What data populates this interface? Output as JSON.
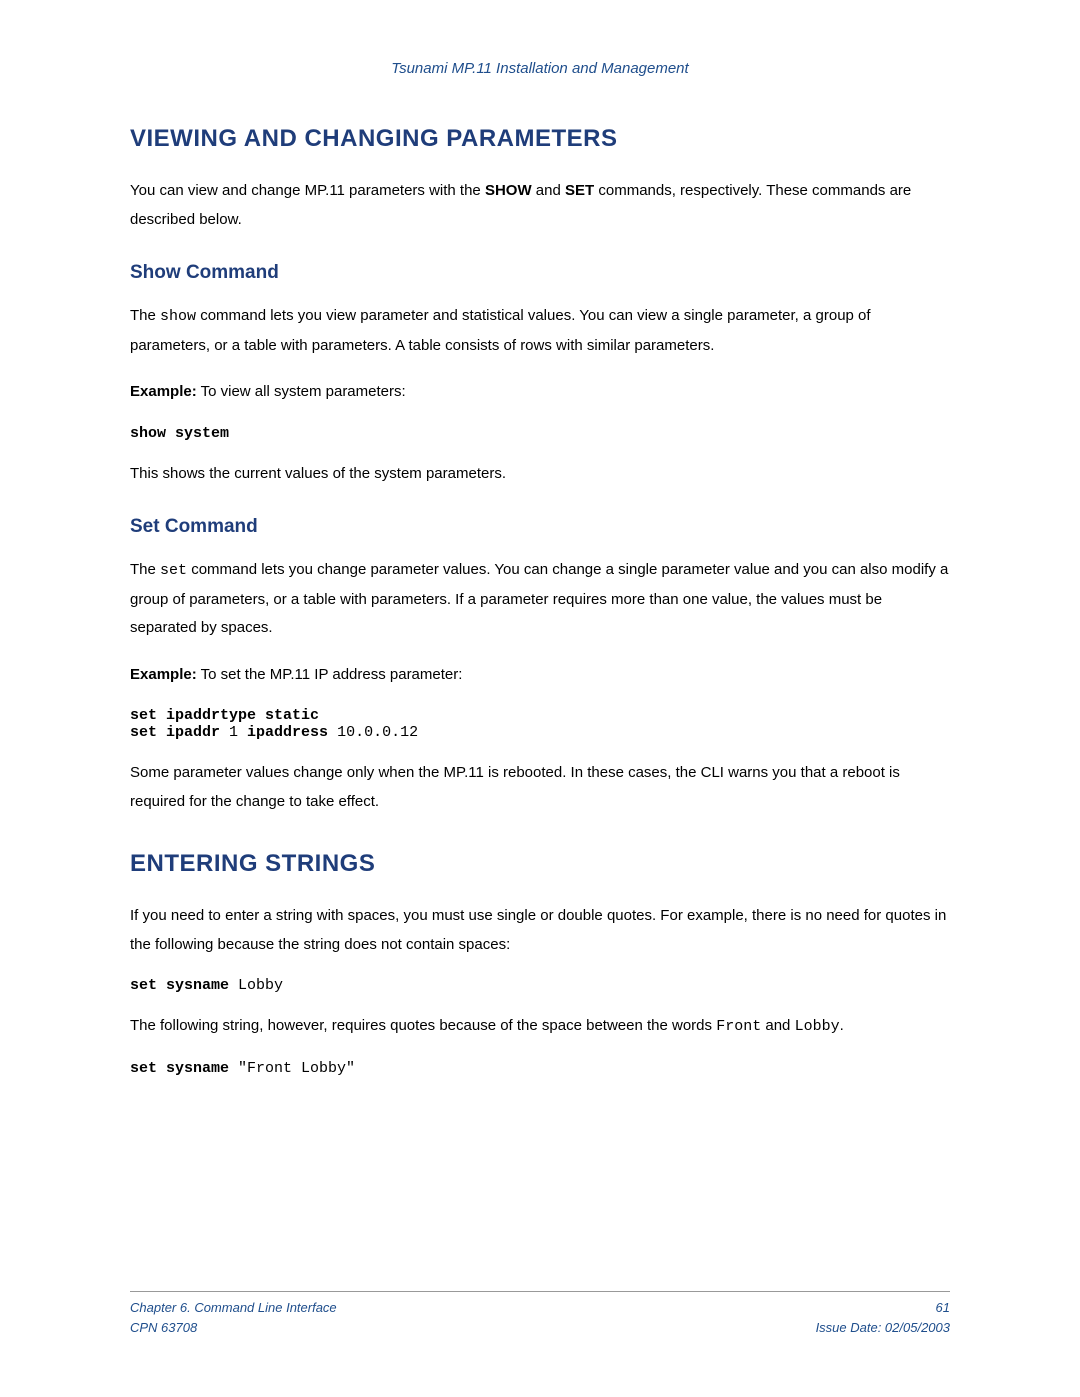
{
  "header": {
    "title": "Tsunami MP.11 Installation and Management"
  },
  "section1": {
    "title": "VIEWING AND CHANGING PARAMETERS",
    "intro_pre": "You can view and change MP.11 parameters with the ",
    "show_cmd": "SHOW",
    "intro_mid": " and ",
    "set_cmd": "SET",
    "intro_post": " commands, respectively. These commands are described below."
  },
  "show": {
    "title": "Show Command",
    "p1_pre": "The ",
    "p1_cmd": "show",
    "p1_post": " command lets you view parameter and statistical values.  You can view a single parameter, a group of parameters, or a table with parameters.  A table consists of rows with similar parameters.",
    "example_label": "Example:",
    "example_text": "  To view all system parameters:",
    "code": "show system",
    "p2": "This shows the current values of the system parameters."
  },
  "set": {
    "title": "Set Command",
    "p1_pre": "The ",
    "p1_cmd": "set",
    "p1_post": " command lets you change parameter values.  You can change a single parameter value and you can also modify a group of parameters, or a table with parameters.  If a parameter requires more than one value, the values must be separated by spaces.",
    "example_label": "Example:",
    "example_text": "  To set the MP.11 IP address parameter:",
    "code_l1_a": "set ipaddrtype static",
    "code_l2_a": "set ipaddr ",
    "code_l2_b": "1",
    "code_l2_c": " ipaddress ",
    "code_l2_d": "10.0.0.12",
    "p2": "Some parameter values change only when the MP.11 is rebooted.  In these cases, the CLI warns you that a reboot is required for the change to take effect."
  },
  "section2": {
    "title": "ENTERING STRINGS",
    "p1": "If you need to enter a string with spaces, you must use single or double quotes. For example, there is no need for quotes in the following because the string does not contain spaces:",
    "code1_a": "set sysname ",
    "code1_b": "Lobby",
    "p2_pre": "The following string, however, requires quotes because of the space between the words ",
    "p2_w1": "Front",
    "p2_mid": " and ",
    "p2_w2": "Lobby",
    "p2_post": ".",
    "code2_a": "set sysname ",
    "code2_b": "\"Front Lobby\""
  },
  "footer": {
    "left1": "Chapter 6.   Command Line Interface",
    "left2": "CPN 63708",
    "right1": "61",
    "right2": "Issue Date:  02/05/2003"
  }
}
